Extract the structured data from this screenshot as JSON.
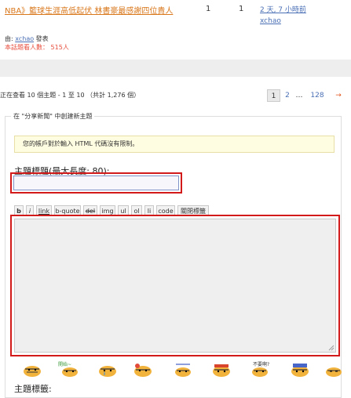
{
  "topic": {
    "title": "NBA》籃球生涯高低起伏 林書豪最感謝四位貴人",
    "replies": "1",
    "views": "1",
    "last_post_time": "2 天, 7 小時前",
    "last_post_user": "xchao",
    "posted_by_prefix": "由:",
    "author": "xchao",
    "posted_by_suffix": "發表",
    "viewers_label": "本話題看人數：",
    "viewers_count": "515人"
  },
  "summary": "正在查看 10 個主題 - 1 至 10 （共計 1,276 個）",
  "pagination": {
    "current": "1",
    "page2": "2",
    "ellipsis": "…",
    "last": "128",
    "next": "→"
  },
  "form": {
    "legend": "在 \"分享新聞\" 中創建新主題",
    "notice": "您的帳戶對於輸入 HTML 代碼沒有限制。",
    "subject_label": "主題標題(最大長度: 80):",
    "subject_value": "",
    "toolbar": [
      "b",
      "i",
      "link",
      "b-quote",
      "del",
      "img",
      "ul",
      "ol",
      "li",
      "code",
      "關閉標籤"
    ],
    "tags_label": "主題標籤:",
    "smileys": [
      "tiger-icon",
      "tiger-wave-icon",
      "tiger-cry-icon",
      "tiger-happy-icon",
      "tiger-look-icon",
      "tiger-angry-icon",
      "tiger-think-icon",
      "tiger-lazy-icon",
      "tiger-sleep-icon"
    ],
    "smiley_texts": [
      "",
      "開始~",
      "",
      "",
      "",
      "",
      "",
      "不要啊?",
      ""
    ]
  },
  "colors": {
    "topic_title": "#d9771b",
    "highlight": "#d21a1a",
    "link_blue": "#4a6fb5",
    "pager_next": "#e2531b",
    "notice_bg": "#fffde1"
  }
}
